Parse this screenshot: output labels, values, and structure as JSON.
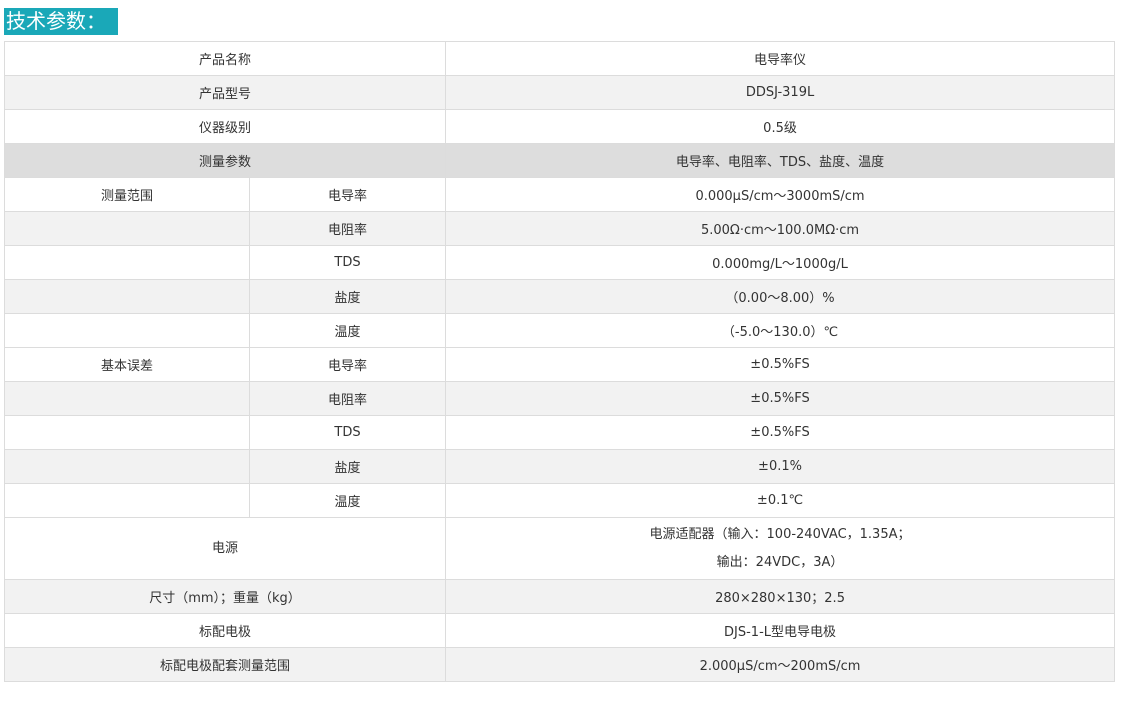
{
  "heading": "技术参数：",
  "rows": [
    {
      "label": "产品名称",
      "value": "电导率仪"
    },
    {
      "label": "产品型号",
      "value": "DDSJ-319L"
    },
    {
      "label": "仪器级别",
      "value": "0.5级"
    },
    {
      "label": "测量参数",
      "value": "电导率、电阻率、TDS、盐度、温度"
    }
  ],
  "measure_range": {
    "group": "测量范围",
    "items": [
      {
        "param": "电导率",
        "value": "0.000μS/cm～3000mS/cm"
      },
      {
        "param": "电阻率",
        "value": "5.00Ω·cm～100.0MΩ·cm"
      },
      {
        "param": "TDS",
        "value": "0.000mg/L～1000g/L"
      },
      {
        "param": "盐度",
        "value": "（0.00～8.00）%"
      },
      {
        "param": "温度",
        "value": "（-5.0～130.0）℃"
      }
    ]
  },
  "basic_error": {
    "group": "基本误差",
    "items": [
      {
        "param": "电导率",
        "value": "±0.5%FS"
      },
      {
        "param": "电阻率",
        "value": "±0.5%FS"
      },
      {
        "param": "TDS",
        "value": "±0.5%FS"
      },
      {
        "param": "盐度",
        "value": "±0.1%"
      },
      {
        "param": "温度",
        "value": "±0.1℃"
      }
    ]
  },
  "power": {
    "label": "电源",
    "line1": "电源适配器（输入：100-240VAC，1.35A；",
    "line2": "输出：24VDC，3A）"
  },
  "tail_rows": [
    {
      "label": "尺寸（mm）；重量（kg）",
      "value": "280×280×130；2.5"
    },
    {
      "label": "标配电极",
      "value": "DJS-1-L型电导电极"
    },
    {
      "label": "标配电极配套测量范围",
      "value": "2.000μS/cm～200mS/cm"
    }
  ]
}
